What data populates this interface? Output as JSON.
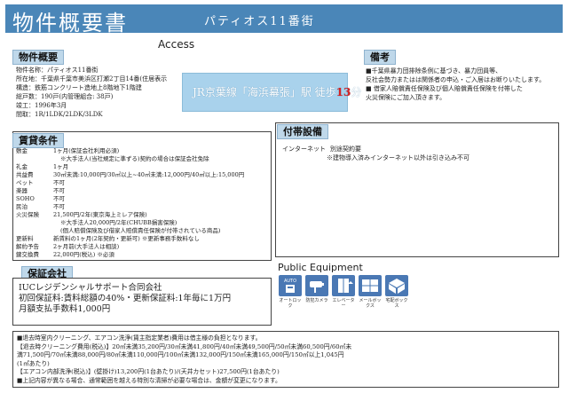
{
  "header": {
    "title": "物件概要書",
    "property_name": "パティオス11番街",
    "access_label": "Access"
  },
  "access": {
    "text": "JR京葉線「海浜幕張」駅 徒歩",
    "minutes": "13",
    "unit": "分"
  },
  "overview": {
    "label": "物件概要",
    "lines": [
      "物件名称：パティオス11番街",
      "所在地：千葉県千葉市美浜区打瀬2丁目14番(住居表示",
      "構造：鉄筋コンクリート造地上8階地下1階建",
      "総戸数：190戸(内管理組合:  38戸)",
      "竣工：1996年3月",
      "間取：1R/1LDK/2LDK/3LDK"
    ]
  },
  "remarks": {
    "label": "備考",
    "lines": [
      "■千葉県暴力団排除条例に基づき、暴力団員等、",
      "反社会勢力またはは関係者の申込・ご入居はお断りいたします。",
      "■ 借家人賠償責任保険及び個人賠償責任保険を付帯した",
      "火災保険にご加入頂きます。"
    ]
  },
  "rental_terms": {
    "label": "賃貸条件",
    "rows": [
      {
        "key": "敷金",
        "value": "1ヶ月(保証会社利用必須)"
      },
      {
        "key": "",
        "value": "※大手法人(当社規定に準ずる)契約の場合は保証会社免除"
      },
      {
        "key": "礼金",
        "value": "1ヶ月"
      },
      {
        "key": "共益費",
        "value": "30㎡未満:10,000円/30㎡以上~40㎡未満:12,000円/40㎡以上:15,000円"
      },
      {
        "key": "ペット",
        "value": "不可"
      },
      {
        "key": "楽器",
        "value": "不可"
      },
      {
        "key": "SOHO",
        "value": "不可"
      },
      {
        "key": "民泊",
        "value": "不可"
      },
      {
        "key": "火災保険",
        "value": "21,500円/2年(東京海上ミレア保険)"
      },
      {
        "key": "",
        "value": "※大手法人20,000円/2年(CHUBB損害保険)"
      },
      {
        "key": "",
        "value": "(個人賠償保険及び借家人賠償責任保険が付帯されている商品)"
      },
      {
        "key": "更新料",
        "value": "新賃料の1ヶ月(2年契約・更新可)  ※更新事務手数料なし"
      },
      {
        "key": "解約予告",
        "value": "2ヶ月前(大手法人は相談)"
      },
      {
        "key": "鍵交換費",
        "value": "22,000円(税込)  ※必須"
      }
    ]
  },
  "facilities": {
    "label": "付帯設備",
    "internet_label": "インターネット",
    "internet_value": "別途契約要",
    "internet_note": "※建物導入済みインターネット以外は引き込み不可"
  },
  "guarantor": {
    "label": "保証会社",
    "lines": [
      "IUCレジデンシャルサポート合同会社",
      "初回保証料:賃料総額の40%・更新保証料:1年毎に1万円",
      "月額支払手数料1,000円"
    ]
  },
  "public_equipment": {
    "title": "Public Equipment",
    "icons": [
      {
        "name": "autolock-icon",
        "caption": "オートロック"
      },
      {
        "name": "security-camera-icon",
        "caption": "防犯カメラ"
      },
      {
        "name": "elevator-icon",
        "caption": "エレベーター"
      },
      {
        "name": "mailbox-icon",
        "caption": "メールボックス"
      },
      {
        "name": "delivery-box-icon",
        "caption": "宅配ボックス"
      }
    ]
  },
  "notes": {
    "lines": [
      "■退去時室内クリーニング、エアコン洗浄(賃主指定業者)費用は借主様の負担となります。",
      "【退去時クリーニング費用(税込)】20㎡未満35,200円/30㎡未満41,800円/40㎡未満49,500円/50㎡未満60,500円/60㎡未",
      "満71,500円/70㎡未満88,000円/80㎡未満110,000円/100㎡未満132,000円/150㎡未満165,000円/150㎡以上1,045円",
      "(1㎡あたり)",
      "【エアコン内部洗浄(税込)】(壁掛け)13,200円(1台あたり)/(天井カセット)27,500円(1台あたり)",
      "■上記内容が異なる場合、通常範囲を越える特別な清掃が必要な場合は、金額が変更になります。"
    ]
  },
  "colors": {
    "header": "#4a86b8",
    "section_label": "#bfd8ea",
    "access_box": "#a9d2ec",
    "accent_red": "#d62020",
    "icon_blue": "#4a78b4"
  }
}
